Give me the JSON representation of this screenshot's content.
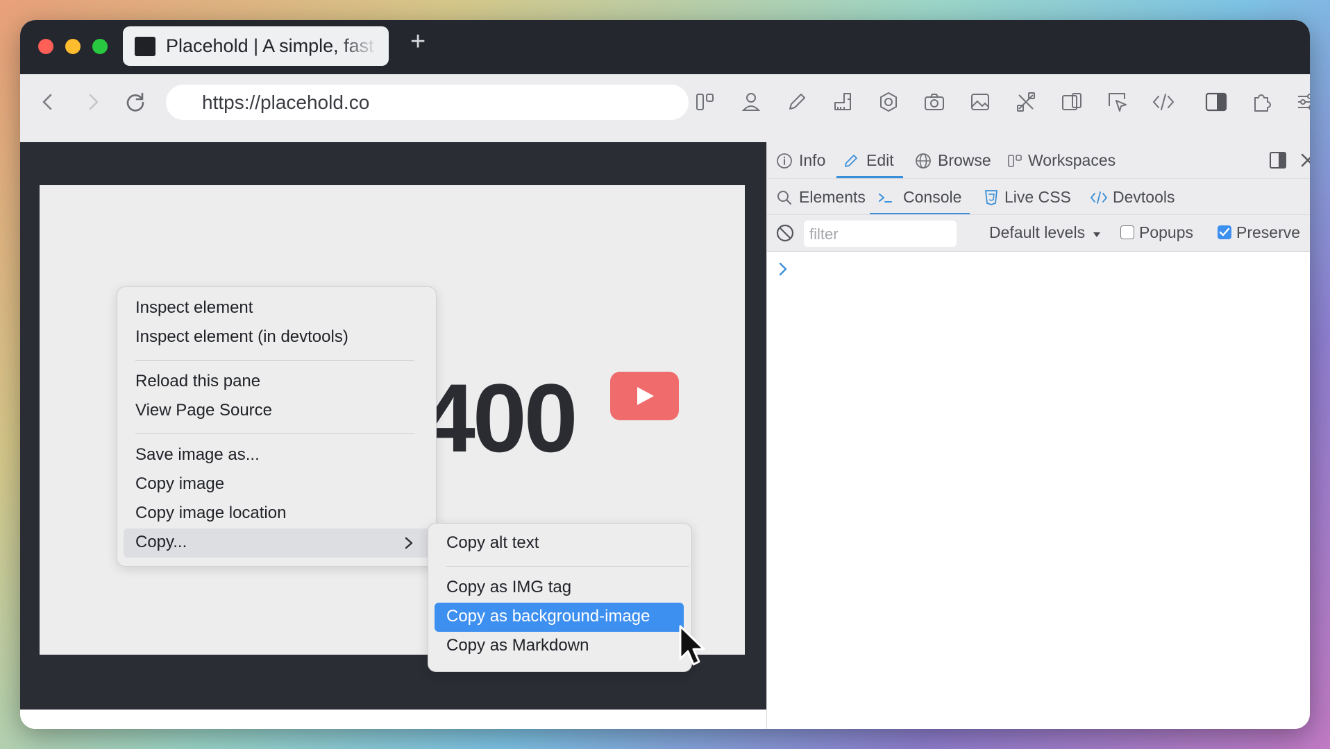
{
  "browser": {
    "tab_title": "Placehold | A simple, fast",
    "new_tab_symbol": "+",
    "url": "https://placehold.co"
  },
  "content": {
    "big_number": "400"
  },
  "context_menu": {
    "items": [
      "Inspect element",
      "Inspect element (in devtools)",
      "Reload this pane",
      "View Page Source",
      "Save image as...",
      "Copy image",
      "Copy image location",
      "Copy..."
    ],
    "highlighted": "Copy..."
  },
  "submenu": {
    "items": [
      "Copy alt text",
      "Copy as IMG tag",
      "Copy as background-image",
      "Copy as Markdown"
    ],
    "highlighted": "Copy as background-image"
  },
  "devtools": {
    "top_tabs": [
      "Info",
      "Edit",
      "Browse",
      "Workspaces"
    ],
    "active_top_tab": "Edit",
    "sub_tabs": [
      "Elements",
      "Console",
      "Live CSS",
      "Devtools"
    ],
    "active_sub_tab": "Console",
    "filter_placeholder": "filter",
    "levels_label": "Default levels",
    "popups_label": "Popups",
    "popups_checked": false,
    "preserve_label": "Preserve",
    "preserve_checked": true
  },
  "colors": {
    "accent": "#3d8ff0",
    "titlebar": "#25272e",
    "youtube": "#f06b6b",
    "traffic_close": "#fe5f57",
    "traffic_min": "#febc2e",
    "traffic_max": "#28c840"
  },
  "icons": {
    "toolbar": [
      "panels-icon",
      "user-icon",
      "pencil-icon",
      "ruler-icon",
      "settings-icon",
      "camera-icon",
      "image-icon",
      "tools-icon",
      "device-icon",
      "cursor-select-icon",
      "code-icon",
      "sidebar-icon",
      "extensions-icon",
      "sliders-icon"
    ]
  }
}
